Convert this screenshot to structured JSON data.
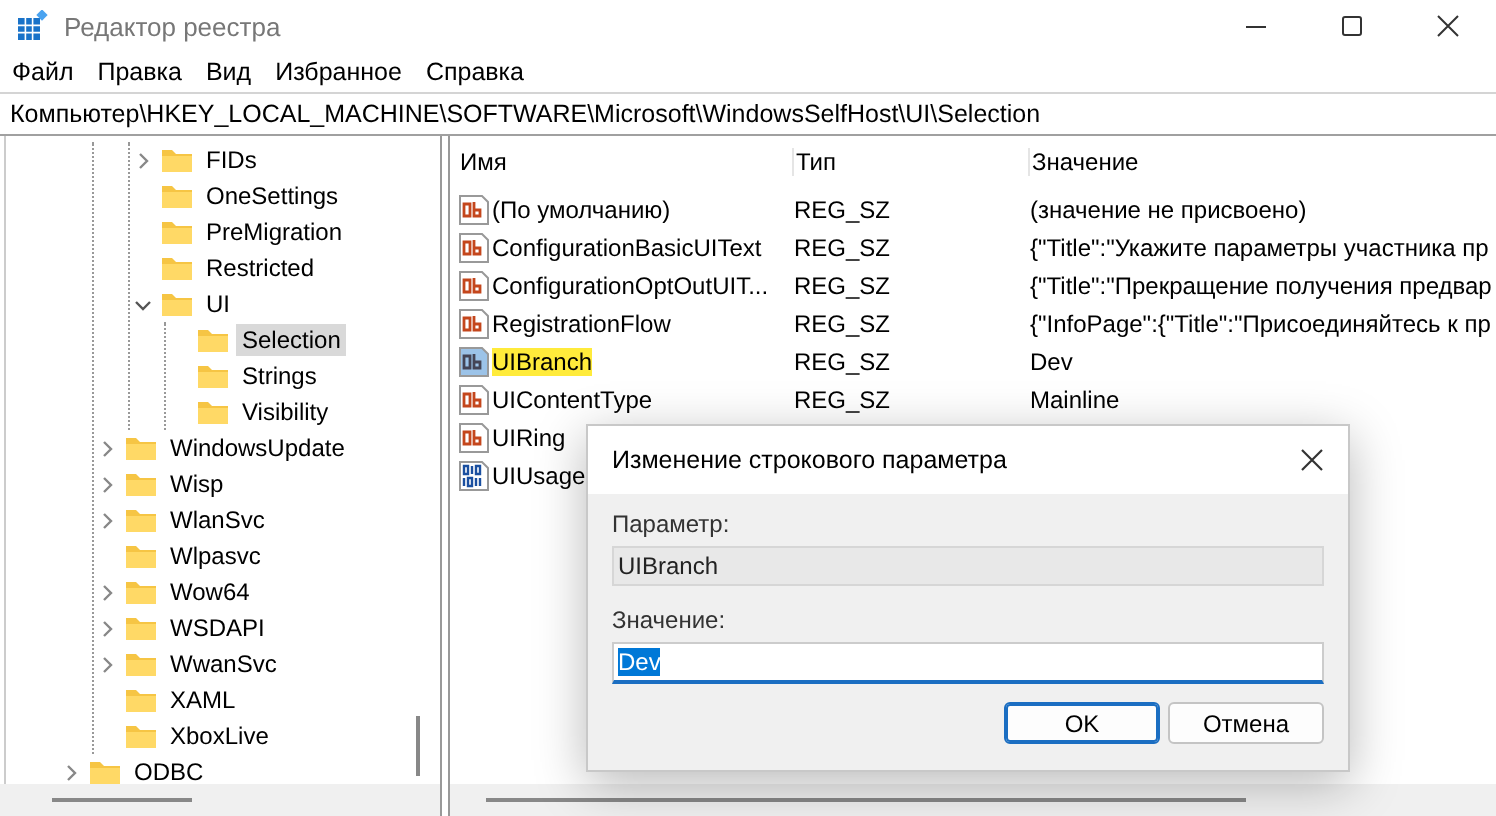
{
  "window": {
    "title": "Редактор реестра"
  },
  "menu": [
    {
      "label": "Файл"
    },
    {
      "label": "Правка"
    },
    {
      "label": "Вид"
    },
    {
      "label": "Избранное"
    },
    {
      "label": "Справка"
    }
  ],
  "address": "Компьютер\\HKEY_LOCAL_MACHINE\\SOFTWARE\\Microsoft\\WindowsSelfHost\\UI\\Selection",
  "tree": {
    "items": [
      {
        "children": [
          {
            "children": [
              {
                "label": "FIDs",
                "expanded": false,
                "selected": false
              },
              {
                "label": "OneSettings",
                "selected": false
              },
              {
                "label": "PreMigration",
                "selected": false
              },
              {
                "label": "Restricted",
                "selected": false
              },
              {
                "label": "UI",
                "expanded": true,
                "selected": false,
                "children": [
                  {
                    "label": "Selection",
                    "selected": true
                  },
                  {
                    "label": "Strings",
                    "selected": false
                  },
                  {
                    "label": "Visibility",
                    "selected": false
                  }
                ]
              }
            ]
          },
          {
            "label": "WindowsUpdate",
            "expanded": false,
            "selected": false
          },
          {
            "label": "Wisp",
            "expanded": false,
            "selected": false
          },
          {
            "label": "WlanSvc",
            "expanded": false,
            "selected": false
          },
          {
            "label": "Wlpasvc",
            "selected": false
          },
          {
            "label": "Wow64",
            "expanded": false,
            "selected": false
          },
          {
            "label": "WSDAPI",
            "expanded": false,
            "selected": false
          },
          {
            "label": "WwanSvc",
            "expanded": false,
            "selected": false
          },
          {
            "label": "XAML",
            "selected": false
          },
          {
            "label": "XboxLive",
            "selected": false
          }
        ]
      },
      {
        "label": "ODBC",
        "expanded": false,
        "selected": false
      }
    ]
  },
  "table": {
    "columns": [
      "Имя",
      "Тип",
      "Значение"
    ],
    "rows": [
      {
        "kind": "string",
        "name": "(По умолчанию)",
        "type": "REG_SZ",
        "value": "(значение не присвоено)",
        "selected": false
      },
      {
        "kind": "string",
        "name": "ConfigurationBasicUIText",
        "type": "REG_SZ",
        "value": "{\"Title\":\"Укажите параметры участника пр",
        "selected": false
      },
      {
        "kind": "string",
        "name": "ConfigurationOptOutUIT...",
        "type": "REG_SZ",
        "value": "{\"Title\":\"Прекращение получения предвар",
        "selected": false
      },
      {
        "kind": "string",
        "name": "RegistrationFlow",
        "type": "REG_SZ",
        "value": "{\"InfoPage\":{\"Title\":\"Присоединяйтесь к пр",
        "selected": false
      },
      {
        "kind": "string",
        "name": "UIBranch",
        "type": "REG_SZ",
        "value": "Dev",
        "selected": true
      },
      {
        "kind": "string",
        "name": "UIContentType",
        "type": "REG_SZ",
        "value": "Mainline",
        "selected": false
      },
      {
        "kind": "string",
        "name": "UIRing",
        "selected": false
      },
      {
        "kind": "binary",
        "name": "UIUsage",
        "selected": false
      }
    ]
  },
  "dialog": {
    "title": "Изменение строкового параметра",
    "name_label": "Параметр:",
    "name_value": "UIBranch",
    "value_label": "Значение:",
    "value": "Dev",
    "value_selected": true,
    "buttons": [
      {
        "label": "OK",
        "default": true
      },
      {
        "label": "Отмена",
        "default": false
      }
    ]
  }
}
